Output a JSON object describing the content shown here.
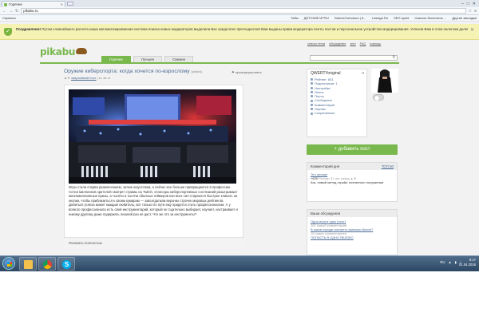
{
  "browser": {
    "tab_title": "Горячее",
    "url": "pikabu.ru",
    "window_controls": [
      "–",
      "□",
      "✕"
    ],
    "bookmarks": [
      "Сервисы",
      "Табы",
      "ДЕТСКИЕ ИГРЫ",
      "GamesTurbodom | К...",
      "Lineage.Ru",
      "SEO sprint",
      "Скачать бесплатно ..."
    ],
    "bookmarks_more": "Другие закладки"
  },
  "notice": {
    "title": "Поздравляем!",
    "text": " Путем сложнейшего расчета наша автоматизированная система поиска новых модераторов выделила Вас среди всех претендентов! Вам выданы права модератора ленты постов и персональное устройство модерирования. Успехов Вам в этом нелегком деле!"
  },
  "top_links": [
    "список тегов",
    "обсуждения",
    "теги",
    "FAQ",
    "помощь"
  ],
  "site": {
    "logo_text": "pikabu",
    "tabs": [
      {
        "label": "Горячее",
        "active": true
      },
      {
        "label": "Лучшее",
        "active": false
      },
      {
        "label": "Свежее",
        "active": false
      }
    ]
  },
  "post": {
    "title": "Оружие киберспорта: когда хочется по-взрослому",
    "tag": "[pikabu]",
    "pin_label": "промодерировать",
    "meta_link": "заархивный пост",
    "meta_rest": " | кт, ab от",
    "text": "Игры стали сперва развлечением, затем искусством, а сейчас все больше превращаются в профессию. Сотни миллионов зрителей смотрят стримы на Twitch, спонсоры киберспортивных состязаний разыгрывают многомиллионные призы, а тысячи и тысячи обычных геймеров изо всех сил стараются быстрее кликать на кнопки, чтобы приблизиться к своим кумирам — завсегдатаям верхних строчек мировых рейтингов. Добиться успеха может каждый любитель, вот только по пути ему придется стать профессионалом. А у всякого профессионала есть свой инструментарий, который он тщательно выбирает, изучает, настраивает и никому другому даже подержать лишний раз не даст. Что же это за инструменты?",
    "read_more": "Показать полностью"
  },
  "profile": {
    "username": "QWERTYoriginal",
    "items": [
      "Рейтинг: 831",
      "Подписчиков: 1",
      "Настройки",
      "Лента",
      "Посты",
      "Сообщения",
      "Комментарии",
      "Оценки",
      "Сохраненные"
    ]
  },
  "add_post_label": "+ добавить пост",
  "comment_of_day": {
    "header": "Комментарий дня",
    "top_link": "ТОП 50",
    "post_link": "Это провал",
    "score": "+835",
    "author": "Реслер",
    "time": "31 час назад",
    "text": "Ага, новый метод страйк: поэтапного погружения"
  },
  "discussions": {
    "header": "Ваши обсуждения",
    "items": [
      {
        "title": "Одна игра в одну (пост)",
        "count": "261 новый комментарий"
      },
      {
        "title": "В каком городе смотреть фильмы Marvel?",
        "count": "18 новых комментариев"
      },
      {
        "title": "ПОПАСТЬ В ОДНО ЯБЛОКО",
        "count": ""
      }
    ]
  },
  "taskbar": {
    "lang": "RU",
    "time": "8:17",
    "date": "01.04.2016"
  }
}
